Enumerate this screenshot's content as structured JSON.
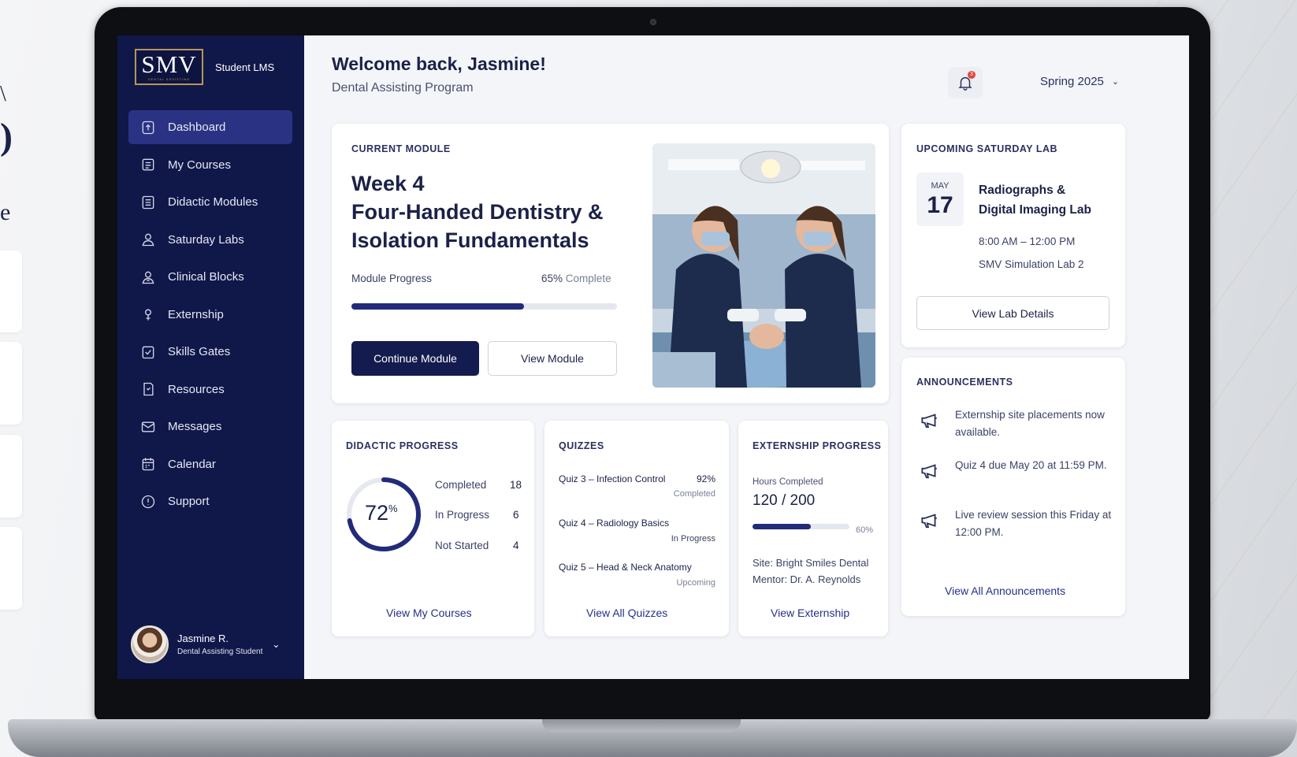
{
  "brand": {
    "logo": "SMV",
    "logo_sub": "DENTAL ASSISTING",
    "label": "Student LMS"
  },
  "nav": [
    {
      "label": "Dashboard",
      "icon": "dashboard-icon",
      "active": true
    },
    {
      "label": "My Courses",
      "icon": "courses-icon"
    },
    {
      "label": "Didactic Modules",
      "icon": "modules-icon"
    },
    {
      "label": "Saturday Labs",
      "icon": "labs-icon"
    },
    {
      "label": "Clinical Blocks",
      "icon": "clinical-icon"
    },
    {
      "label": "Externship",
      "icon": "externship-icon"
    },
    {
      "label": "Skills Gates",
      "icon": "skills-icon"
    },
    {
      "label": "Resources",
      "icon": "resources-icon"
    },
    {
      "label": "Messages",
      "icon": "messages-icon"
    },
    {
      "label": "Calendar",
      "icon": "calendar-icon"
    },
    {
      "label": "Support",
      "icon": "support-icon"
    }
  ],
  "user": {
    "name": "Jasmine R.",
    "role": "Dental Assisting Student"
  },
  "header": {
    "welcome": "Welcome back, Jasmine!",
    "program": "Dental Assisting Program",
    "notification_count": "3",
    "term": "Spring 2025"
  },
  "current_module": {
    "label": "CURRENT MODULE",
    "title_line1": "Week 4",
    "title_line2": "Four-Handed Dentistry &",
    "title_line3": "Isolation Fundamentals",
    "progress_label": "Module Progress",
    "progress_pct": "65%",
    "progress_suffix": "Complete",
    "progress_value": 0.65,
    "continue_label": "Continue Module",
    "view_label": "View Module"
  },
  "saturday_lab": {
    "label": "UPCOMING SATURDAY LAB",
    "month": "MAY",
    "day": "17",
    "title_line1": "Radiographs &",
    "title_line2": "Digital Imaging Lab",
    "time": "8:00 AM – 12:00 PM",
    "location": "SMV Simulation Lab 2",
    "button": "View Lab Details"
  },
  "announcements": {
    "label": "ANNOUNCEMENTS",
    "items": [
      {
        "text": "Externship site placements now available."
      },
      {
        "text": "Quiz 4 due May 20 at 11:59 PM."
      },
      {
        "text": "Live review session this Friday at 12:00 PM."
      }
    ],
    "link": "View All Announcements"
  },
  "didactic": {
    "label": "DIDACTIC PROGRESS",
    "percent": "72",
    "percent_sign": "%",
    "progress_value": 0.72,
    "stats": [
      {
        "label": "Completed",
        "value": "18"
      },
      {
        "label": "In Progress",
        "value": "6"
      },
      {
        "label": "Not Started",
        "value": "4"
      }
    ],
    "link": "View My Courses"
  },
  "quizzes": {
    "label": "QUIZZES",
    "items": [
      {
        "name": "Quiz 3 – Infection Control",
        "score": "92%",
        "status": "Completed"
      },
      {
        "name": "Quiz 4 – Radiology Basics",
        "score": "",
        "status": "In Progress"
      },
      {
        "name": "Quiz 5 – Head & Neck Anatomy",
        "score": "",
        "status": "Upcoming"
      }
    ],
    "link": "View All Quizzes"
  },
  "externship": {
    "label": "EXTERNSHIP PROGRESS",
    "hours_label": "Hours Completed",
    "hours": "120 / 200",
    "pct": "60%",
    "progress_value": 0.6,
    "site": "Site: Bright Smiles Dental",
    "mentor": "Mentor: Dr. A. Reynolds",
    "link": "View Externship"
  },
  "colors": {
    "sidebar": "#10184a",
    "accent": "#222b7a",
    "active_nav": "#2a3383",
    "badge": "#e2463e"
  }
}
